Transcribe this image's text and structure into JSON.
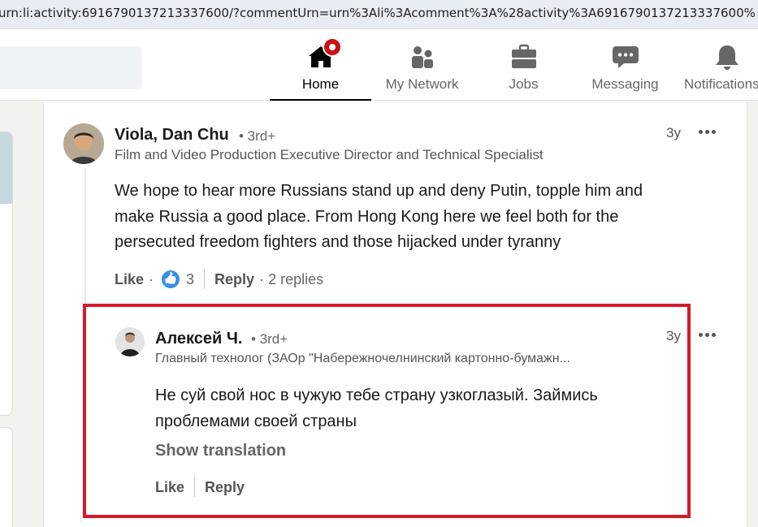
{
  "browser": {
    "url": "urn:li:activity:6916790137213337600/?commentUrn=urn%3Ali%3Acomment%3A%28activity%3A6916790137213337600%"
  },
  "nav": {
    "items": [
      {
        "label": "Home",
        "icon": "home-icon",
        "active": true
      },
      {
        "label": "My Network",
        "icon": "people-icon"
      },
      {
        "label": "Jobs",
        "icon": "briefcase-icon"
      },
      {
        "label": "Messaging",
        "icon": "chat-icon"
      },
      {
        "label": "Notifications",
        "icon": "bell-icon"
      }
    ]
  },
  "comment": {
    "author": "Viola, Dan Chu",
    "degree": "• 3rd+",
    "headline": "Film and Video Production Executive Director and Technical Specialist",
    "time": "3y",
    "text_lines": [
      "We hope to hear more Russians stand up and deny Putin, topple him and",
      "make Russia a good place. From Hong Kong here we feel both for the",
      "persecuted freedom fighters and those hijacked under tyranny"
    ],
    "like_label": "Like",
    "like_sep": "·",
    "reaction_count": "3",
    "reply_label": "Reply",
    "replies": "· 2 replies"
  },
  "reply": {
    "author": "Алексей Ч.",
    "degree": "• 3rd+",
    "headline": "Главный технолог (ЗАОр \"Набережночелнинский картонно-бумажн...",
    "time": "3y",
    "text_lines": [
      "Не суй свой нос в чужую тебе страну узкоглазый. Займись",
      "проблемами своей страны"
    ],
    "show_translation": "Show translation",
    "like_label": "Like",
    "reply_label": "Reply"
  },
  "colors": {
    "highlight": "#d61a2a",
    "notification_badge": "#cc1016",
    "reaction_blue": "#378fe9"
  }
}
